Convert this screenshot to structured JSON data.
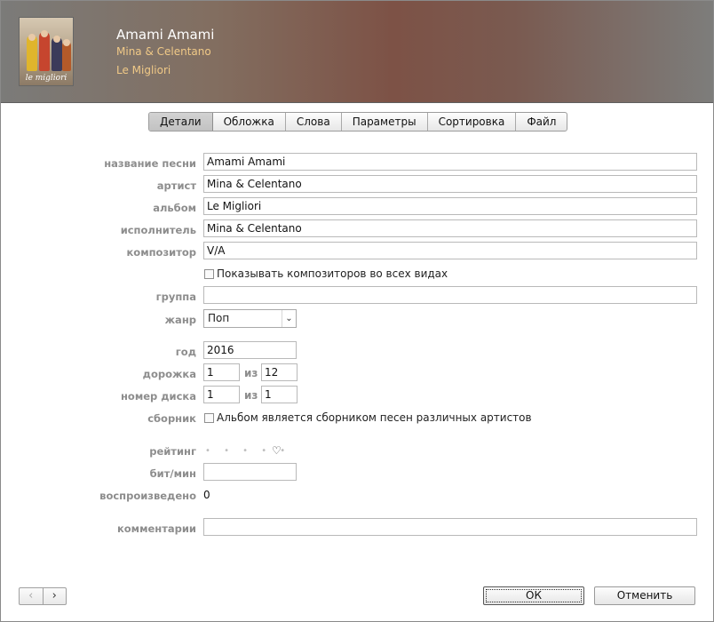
{
  "header": {
    "cover_text": "le migliori",
    "title": "Amami Amami",
    "artist": "Mina & Celentano",
    "album": "Le Migliori"
  },
  "tabs": [
    {
      "label": "Детали",
      "active": true
    },
    {
      "label": "Обложка"
    },
    {
      "label": "Слова"
    },
    {
      "label": "Параметры"
    },
    {
      "label": "Сортировка"
    },
    {
      "label": "Файл"
    }
  ],
  "form": {
    "song_name": {
      "label": "название песни",
      "value": "Amami Amami"
    },
    "artist": {
      "label": "артист",
      "value": "Mina & Celentano"
    },
    "album": {
      "label": "альбом",
      "value": "Le Migliori"
    },
    "album_artist": {
      "label": "исполнитель",
      "value": "Mina & Celentano"
    },
    "composer": {
      "label": "композитор",
      "value": "V/A"
    },
    "show_composers": {
      "label": "Показывать композиторов во всех видах",
      "checked": false
    },
    "grouping": {
      "label": "группа",
      "value": ""
    },
    "genre": {
      "label": "жанр",
      "value": "Поп"
    },
    "year": {
      "label": "год",
      "value": "2016"
    },
    "track": {
      "label": "дорожка",
      "value": "1",
      "of_label": "из",
      "of_value": "12"
    },
    "disc": {
      "label": "номер диска",
      "value": "1",
      "of_label": "из",
      "of_value": "1"
    },
    "compilation": {
      "label": "сборник",
      "checkbox_label": "Альбом является сборником песен различных артистов",
      "checked": false
    },
    "rating": {
      "label": "рейтинг",
      "dots": "• • • • •",
      "heart": "♡"
    },
    "bpm": {
      "label": "бит/мин",
      "value": ""
    },
    "plays": {
      "label": "воспроизведено",
      "value": "0"
    },
    "comments": {
      "label": "комментарии",
      "value": ""
    }
  },
  "footer": {
    "prev": "‹",
    "next": "›",
    "ok_label": "ОК",
    "cancel_label": "Отменить"
  }
}
